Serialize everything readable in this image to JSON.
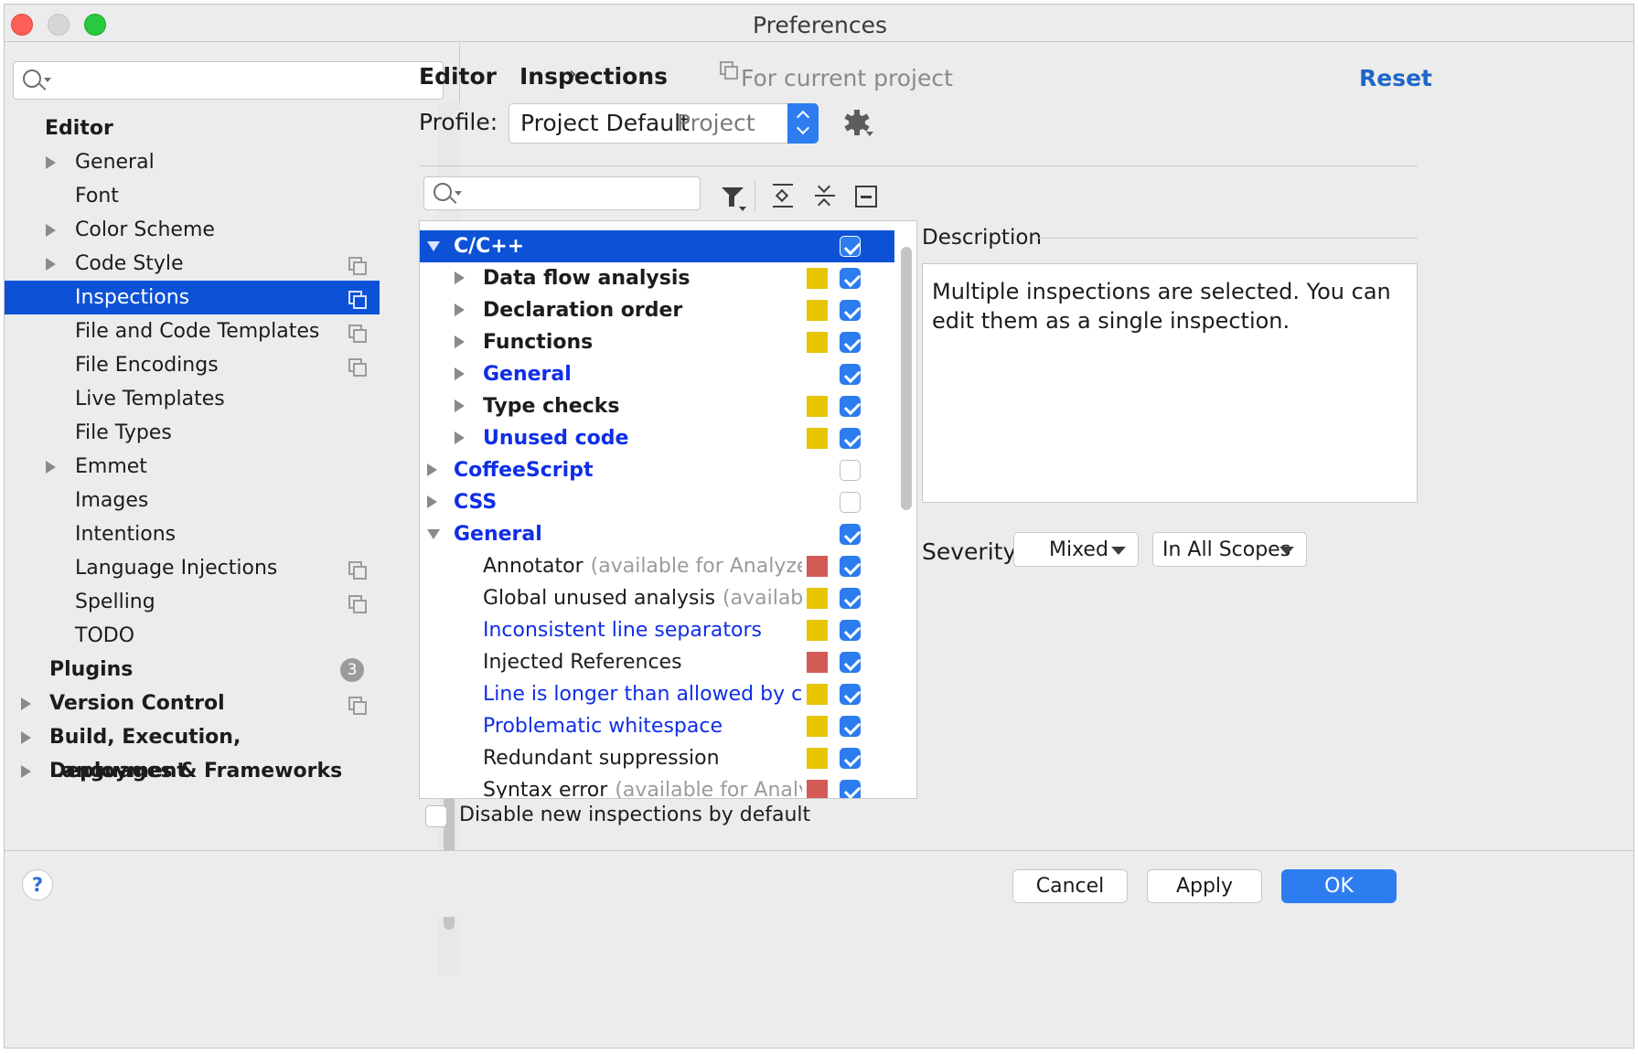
{
  "window": {
    "title": "Preferences"
  },
  "sidebar": {
    "items": [
      {
        "label": "Editor",
        "bold": true,
        "arrow": false,
        "indent": 0
      },
      {
        "label": "General",
        "arrow": true,
        "indent": 1
      },
      {
        "label": "Font",
        "arrow": false,
        "indent": 1
      },
      {
        "label": "Color Scheme",
        "arrow": true,
        "indent": 1
      },
      {
        "label": "Code Style",
        "arrow": true,
        "indent": 1,
        "project_icon": true
      },
      {
        "label": "Inspections",
        "arrow": false,
        "indent": 1,
        "project_icon": true,
        "selected": true
      },
      {
        "label": "File and Code Templates",
        "arrow": false,
        "indent": 1,
        "project_icon": true
      },
      {
        "label": "File Encodings",
        "arrow": false,
        "indent": 1,
        "project_icon": true
      },
      {
        "label": "Live Templates",
        "arrow": false,
        "indent": 1
      },
      {
        "label": "File Types",
        "arrow": false,
        "indent": 1
      },
      {
        "label": "Emmet",
        "arrow": true,
        "indent": 1
      },
      {
        "label": "Images",
        "arrow": false,
        "indent": 1
      },
      {
        "label": "Intentions",
        "arrow": false,
        "indent": 1
      },
      {
        "label": "Language Injections",
        "arrow": false,
        "indent": 1,
        "project_icon": true
      },
      {
        "label": "Spelling",
        "arrow": false,
        "indent": 1,
        "project_icon": true
      },
      {
        "label": "TODO",
        "arrow": false,
        "indent": 1
      },
      {
        "label": "Plugins",
        "bold": true,
        "arrow": false,
        "indent": 0,
        "badge": "3"
      },
      {
        "label": "Version Control",
        "bold": true,
        "arrow": true,
        "indent": 0,
        "project_icon": true
      },
      {
        "label": "Build, Execution, Deployment",
        "bold": true,
        "arrow": true,
        "indent": 0
      },
      {
        "label": "Languages & Frameworks",
        "bold": true,
        "arrow": true,
        "indent": 0
      }
    ]
  },
  "header": {
    "crumb_parent": "Editor",
    "crumb_current": "Inspections",
    "scope_note": "For current project",
    "reset_label": "Reset"
  },
  "profile": {
    "label": "Profile:",
    "value": "Project Default",
    "hint": "Project"
  },
  "tree": {
    "rows": [
      {
        "label": "C/C++",
        "level": 0,
        "expand": "down",
        "bold": true,
        "color": "default",
        "severity": null,
        "checked": true,
        "selected": true
      },
      {
        "label": "Data flow analysis",
        "level": 1,
        "expand": "right",
        "bold": true,
        "color": "default",
        "severity": "yellow",
        "checked": true
      },
      {
        "label": "Declaration order",
        "level": 1,
        "expand": "right",
        "bold": true,
        "color": "default",
        "severity": "yellow",
        "checked": true
      },
      {
        "label": "Functions",
        "level": 1,
        "expand": "right",
        "bold": true,
        "color": "default",
        "severity": "yellow",
        "checked": true
      },
      {
        "label": "General",
        "level": 1,
        "expand": "right",
        "bold": true,
        "color": "blue",
        "severity": null,
        "checked": true
      },
      {
        "label": "Type checks",
        "level": 1,
        "expand": "right",
        "bold": true,
        "color": "default",
        "severity": "yellow",
        "checked": true
      },
      {
        "label": "Unused code",
        "level": 1,
        "expand": "right",
        "bold": true,
        "color": "blue",
        "severity": "yellow",
        "checked": true
      },
      {
        "label": "CoffeeScript",
        "level": 0,
        "expand": "right",
        "bold": true,
        "color": "blue",
        "severity": null,
        "checked": false
      },
      {
        "label": "CSS",
        "level": 0,
        "expand": "right",
        "bold": true,
        "color": "blue",
        "severity": null,
        "checked": false
      },
      {
        "label": "General",
        "level": 0,
        "expand": "down",
        "bold": true,
        "color": "blue",
        "severity": null,
        "checked": true
      },
      {
        "label": "Annotator",
        "dim": "(available for Analyze",
        "level": 2,
        "bold": false,
        "color": "default",
        "severity": "red",
        "checked": true
      },
      {
        "label": "Global unused analysis",
        "dim": "(available",
        "level": 2,
        "bold": false,
        "color": "default",
        "severity": "yellow",
        "checked": true
      },
      {
        "label": "Inconsistent line separators",
        "level": 2,
        "bold": false,
        "color": "blue",
        "severity": "yellow",
        "checked": true
      },
      {
        "label": "Injected References",
        "level": 2,
        "bold": false,
        "color": "default",
        "severity": "red",
        "checked": true
      },
      {
        "label": "Line is longer than allowed by cc",
        "level": 2,
        "bold": false,
        "color": "blue",
        "severity": "yellow",
        "checked": true
      },
      {
        "label": "Problematic whitespace",
        "level": 2,
        "bold": false,
        "color": "blue",
        "severity": "yellow",
        "checked": true
      },
      {
        "label": "Redundant suppression",
        "level": 2,
        "bold": false,
        "color": "default",
        "severity": "yellow",
        "checked": true
      },
      {
        "label": "Syntax error",
        "dim": "(available for Analy:",
        "level": 2,
        "bold": false,
        "color": "default",
        "severity": "red",
        "checked": true
      }
    ]
  },
  "description": {
    "label": "Description",
    "text": "Multiple inspections are selected. You can edit them as a single inspection."
  },
  "severity": {
    "label": "Severity:",
    "value": "Mixed",
    "scope": "In All Scopes"
  },
  "disable_new": {
    "label": "Disable new inspections by default",
    "checked": false
  },
  "footer": {
    "help": "?",
    "cancel": "Cancel",
    "apply": "Apply",
    "ok": "OK"
  },
  "colors": {
    "accent": "#0d52d6",
    "link_blue": "#0f2ee6",
    "severity_yellow": "#e8c400",
    "severity_red": "#d35a57",
    "checkbox": "#2d7cf0"
  },
  "icons": [
    "search-icon",
    "gear-icon",
    "filter-icon",
    "expand-all-icon",
    "collapse-all-icon",
    "group-icon",
    "project-scope-icon",
    "help-icon"
  ]
}
